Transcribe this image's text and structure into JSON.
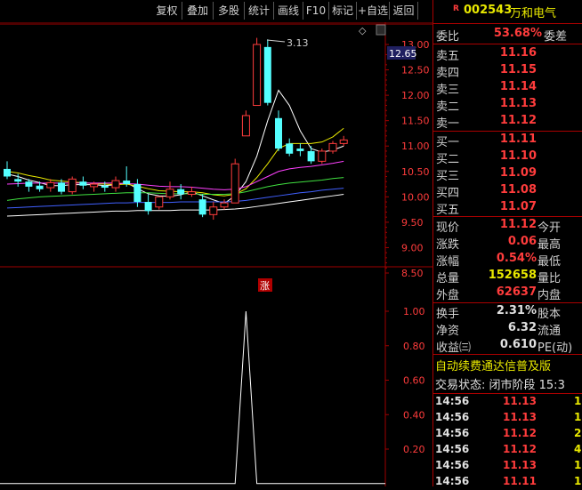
{
  "toolbar": {
    "buttons": [
      "复权",
      "叠加",
      "多股",
      "统计",
      "画线",
      "F10",
      "标记",
      "+自选",
      "返回"
    ]
  },
  "stock": {
    "badge": "R",
    "code": "002543",
    "name": "万和电气"
  },
  "orderbook": {
    "weibi_label": "委比",
    "weibi_value": "53.68%",
    "weicha_label": "委差",
    "asks": [
      {
        "label": "卖五",
        "price": "11.16"
      },
      {
        "label": "卖四",
        "price": "11.15"
      },
      {
        "label": "卖三",
        "price": "11.14"
      },
      {
        "label": "卖二",
        "price": "11.13"
      },
      {
        "label": "卖一",
        "price": "11.12"
      }
    ],
    "bids": [
      {
        "label": "买一",
        "price": "11.11"
      },
      {
        "label": "买二",
        "price": "11.10"
      },
      {
        "label": "买三",
        "price": "11.09"
      },
      {
        "label": "买四",
        "price": "11.08"
      },
      {
        "label": "买五",
        "price": "11.07"
      }
    ]
  },
  "quote": {
    "rows": [
      {
        "label": "现价",
        "value": "11.12",
        "label2": "今开"
      },
      {
        "label": "涨跌",
        "value": "0.06",
        "label2": "最高"
      },
      {
        "label": "涨幅",
        "value": "0.54%",
        "label2": "最低"
      },
      {
        "label": "总量",
        "value": "152658",
        "label2": "量比"
      },
      {
        "label": "外盘",
        "value": "62637",
        "label2": "内盘"
      }
    ],
    "rows2": [
      {
        "label": "换手",
        "value": "2.31%",
        "label2": "股本"
      },
      {
        "label": "净资",
        "value": "6.32",
        "label2": "流通"
      },
      {
        "label": "收益㈢",
        "value": "0.610",
        "label2": "PE(动)"
      }
    ]
  },
  "banner": "自动续费通达信普及版",
  "trade_status": "交易状态: 闭市阶段 15:3",
  "ticks": [
    {
      "time": "14:56",
      "price": "11.13",
      "vol": "1"
    },
    {
      "time": "14:56",
      "price": "11.13",
      "vol": "1"
    },
    {
      "time": "14:56",
      "price": "11.12",
      "vol": "2"
    },
    {
      "time": "14:56",
      "price": "11.12",
      "vol": "4"
    },
    {
      "time": "14:56",
      "price": "11.13",
      "vol": "1"
    },
    {
      "time": "14:56",
      "price": "11.11",
      "vol": "1"
    }
  ],
  "chart_data": [
    {
      "type": "candlestick",
      "y_axis_ticks": [
        "13.00",
        "12.50",
        "12.00",
        "11.50",
        "11.00",
        "10.50",
        "10.00",
        "9.50",
        "9.00",
        "8.50"
      ],
      "ylim": [
        8.5,
        13.0
      ],
      "current_price_label": "12.65",
      "high_annotation": "3.13",
      "marker_label": "涨",
      "candles": [
        {
          "o": 10.55,
          "h": 10.7,
          "c": 10.4,
          "l": 10.35
        },
        {
          "o": 10.35,
          "h": 10.45,
          "c": 10.3,
          "l": 10.2
        },
        {
          "o": 10.3,
          "h": 10.35,
          "c": 10.2,
          "l": 10.1
        },
        {
          "o": 10.22,
          "h": 10.3,
          "c": 10.15,
          "l": 10.1
        },
        {
          "o": 10.18,
          "h": 10.35,
          "c": 10.28,
          "l": 10.1
        },
        {
          "o": 10.28,
          "h": 10.35,
          "c": 10.1,
          "l": 10.05
        },
        {
          "o": 10.1,
          "h": 10.4,
          "c": 10.35,
          "l": 10.05
        },
        {
          "o": 10.3,
          "h": 10.4,
          "c": 10.22,
          "l": 10.15
        },
        {
          "o": 10.2,
          "h": 10.3,
          "c": 10.25,
          "l": 10.1
        },
        {
          "o": 10.22,
          "h": 10.3,
          "c": 10.18,
          "l": 10.1
        },
        {
          "o": 10.18,
          "h": 10.4,
          "c": 10.32,
          "l": 10.1
        },
        {
          "o": 10.32,
          "h": 10.6,
          "c": 10.25,
          "l": 10.2
        },
        {
          "o": 10.25,
          "h": 10.35,
          "c": 9.9,
          "l": 9.8
        },
        {
          "o": 9.9,
          "h": 10.05,
          "c": 9.72,
          "l": 9.65
        },
        {
          "o": 9.8,
          "h": 9.95,
          "c": 10.0,
          "l": 9.75
        },
        {
          "o": 10.0,
          "h": 10.3,
          "c": 10.15,
          "l": 9.95
        },
        {
          "o": 10.15,
          "h": 10.25,
          "c": 10.05,
          "l": 9.95
        },
        {
          "o": 10.05,
          "h": 10.2,
          "c": 10.1,
          "l": 10.0
        },
        {
          "o": 9.95,
          "h": 10.05,
          "c": 9.65,
          "l": 9.6
        },
        {
          "o": 9.65,
          "h": 9.9,
          "c": 9.8,
          "l": 9.55
        },
        {
          "o": 9.8,
          "h": 9.95,
          "c": 9.88,
          "l": 9.75
        },
        {
          "o": 9.88,
          "h": 10.75,
          "c": 10.65,
          "l": 9.88
        },
        {
          "o": 11.2,
          "h": 11.7,
          "c": 11.6,
          "l": 11.2
        },
        {
          "o": 11.8,
          "h": 13.13,
          "c": 13.0,
          "l": 11.8
        },
        {
          "o": 12.95,
          "h": 13.1,
          "c": 11.85,
          "l": 11.8
        },
        {
          "o": 11.55,
          "h": 11.7,
          "c": 10.95,
          "l": 10.9
        },
        {
          "o": 11.05,
          "h": 11.15,
          "c": 10.85,
          "l": 10.8
        },
        {
          "o": 10.95,
          "h": 11.05,
          "c": 10.9,
          "l": 10.8
        },
        {
          "o": 10.9,
          "h": 11.0,
          "c": 10.7,
          "l": 10.65
        },
        {
          "o": 10.7,
          "h": 10.95,
          "c": 10.9,
          "l": 10.65
        },
        {
          "o": 10.9,
          "h": 11.1,
          "c": 11.05,
          "l": 10.85
        },
        {
          "o": 11.05,
          "h": 11.2,
          "c": 11.12,
          "l": 11.0
        }
      ],
      "ma": [
        {
          "name": "MA5",
          "color": "#ffffff",
          "values": [
            10.45,
            10.4,
            10.33,
            10.28,
            10.22,
            10.22,
            10.24,
            10.24,
            10.24,
            10.22,
            10.24,
            10.28,
            10.16,
            10.06,
            10.02,
            10.01,
            10.04,
            10.1,
            10.02,
            9.94,
            9.87,
            10.02,
            10.3,
            10.8,
            11.5,
            12.1,
            11.8,
            11.3,
            10.95,
            10.88,
            10.92,
            11.0
          ]
        },
        {
          "name": "MA10",
          "color": "#e8e800",
          "values": [
            10.5,
            10.47,
            10.42,
            10.38,
            10.33,
            10.31,
            10.29,
            10.28,
            10.26,
            10.25,
            10.24,
            10.25,
            10.21,
            10.16,
            10.12,
            10.11,
            10.1,
            10.1,
            10.08,
            10.04,
            10.02,
            10.05,
            10.16,
            10.38,
            10.65,
            10.95,
            11.05,
            11.05,
            11.05,
            11.08,
            11.18,
            11.35
          ]
        },
        {
          "name": "MA20",
          "color": "#ff40ff",
          "values": [
            10.25,
            10.26,
            10.27,
            10.27,
            10.27,
            10.27,
            10.27,
            10.27,
            10.27,
            10.27,
            10.27,
            10.26,
            10.25,
            10.23,
            10.21,
            10.2,
            10.2,
            10.19,
            10.17,
            10.15,
            10.14,
            10.15,
            10.2,
            10.3,
            10.4,
            10.5,
            10.55,
            10.58,
            10.6,
            10.63,
            10.66,
            10.7
          ]
        },
        {
          "name": "MA30",
          "color": "#40e040",
          "values": [
            9.93,
            9.96,
            9.98,
            10.0,
            10.01,
            10.02,
            10.03,
            10.04,
            10.05,
            10.06,
            10.07,
            10.08,
            10.08,
            10.08,
            10.07,
            10.06,
            10.06,
            10.06,
            10.05,
            10.05,
            10.05,
            10.06,
            10.1,
            10.15,
            10.2,
            10.24,
            10.27,
            10.29,
            10.31,
            10.33,
            10.36,
            10.38
          ]
        },
        {
          "name": "MA60",
          "color": "#4060ff",
          "values": [
            9.78,
            9.79,
            9.8,
            9.81,
            9.82,
            9.83,
            9.84,
            9.85,
            9.86,
            9.87,
            9.88,
            9.88,
            9.89,
            9.89,
            9.89,
            9.89,
            9.9,
            9.9,
            9.9,
            9.9,
            9.9,
            9.91,
            9.93,
            9.96,
            9.99,
            10.02,
            10.05,
            10.08,
            10.1,
            10.13,
            10.15,
            10.17
          ]
        },
        {
          "name": "MA120",
          "color": "#ffffff",
          "values": [
            9.62,
            9.63,
            9.64,
            9.65,
            9.66,
            9.67,
            9.68,
            9.69,
            9.7,
            9.71,
            9.72,
            9.72,
            9.73,
            9.73,
            9.73,
            9.73,
            9.74,
            9.74,
            9.74,
            9.74,
            9.75,
            9.76,
            9.78,
            9.81,
            9.84,
            9.87,
            9.9,
            9.93,
            9.96,
            9.99,
            10.02,
            10.05
          ]
        }
      ]
    },
    {
      "type": "line",
      "y_axis_ticks": [
        "1.00",
        "0.80",
        "0.60",
        "0.40",
        "0.20"
      ],
      "ylim": [
        0,
        1.0
      ],
      "values": [
        0,
        0,
        0,
        0,
        0,
        0,
        0,
        0,
        0,
        0,
        0,
        0,
        0,
        0,
        0,
        0,
        0,
        0,
        0,
        0,
        0,
        0,
        1.0,
        0,
        0,
        0,
        0,
        0,
        0,
        0,
        0,
        0
      ]
    }
  ]
}
